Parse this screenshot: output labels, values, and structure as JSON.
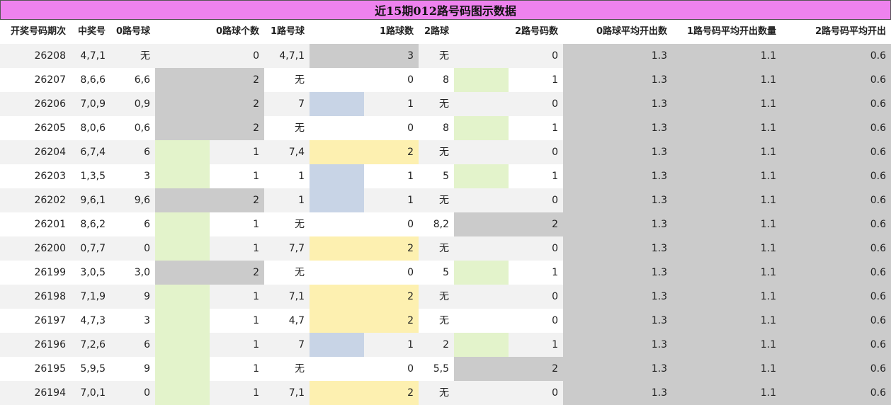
{
  "title": "近15期012路号码图示数据",
  "headers": [
    "开奖号码期次",
    "中奖号",
    "0路号球",
    "0路球个数",
    "1路号球",
    "1路球数",
    "2路球",
    "2路号码数",
    "0路球平均开出数",
    "1路号码平均开出数量",
    "2路号码平均开出"
  ],
  "colors": {
    "title_bg": "#ee82ee",
    "gray": "#cbcbcb",
    "green": "#e3f3cb",
    "blue": "#c8d4e6",
    "yellow": "#fdf0b0"
  },
  "rows": [
    {
      "period": "26208",
      "draw": "4,7,1",
      "r0": "无",
      "c0": "0",
      "r1": "4,7,1",
      "c1": "3",
      "r2": "无",
      "c2": "0",
      "a0": "1.3",
      "a1": "1.1",
      "a2": "0.6"
    },
    {
      "period": "26207",
      "draw": "8,6,6",
      "r0": "6,6",
      "c0": "2",
      "r1": "无",
      "c1": "0",
      "r2": "8",
      "c2": "1",
      "a0": "1.3",
      "a1": "1.1",
      "a2": "0.6"
    },
    {
      "period": "26206",
      "draw": "7,0,9",
      "r0": "0,9",
      "c0": "2",
      "r1": "7",
      "c1": "1",
      "r2": "无",
      "c2": "0",
      "a0": "1.3",
      "a1": "1.1",
      "a2": "0.6"
    },
    {
      "period": "26205",
      "draw": "8,0,6",
      "r0": "0,6",
      "c0": "2",
      "r1": "无",
      "c1": "0",
      "r2": "8",
      "c2": "1",
      "a0": "1.3",
      "a1": "1.1",
      "a2": "0.6"
    },
    {
      "period": "26204",
      "draw": "6,7,4",
      "r0": "6",
      "c0": "1",
      "r1": "7,4",
      "c1": "2",
      "r2": "无",
      "c2": "0",
      "a0": "1.3",
      "a1": "1.1",
      "a2": "0.6"
    },
    {
      "period": "26203",
      "draw": "1,3,5",
      "r0": "3",
      "c0": "1",
      "r1": "1",
      "c1": "1",
      "r2": "5",
      "c2": "1",
      "a0": "1.3",
      "a1": "1.1",
      "a2": "0.6"
    },
    {
      "period": "26202",
      "draw": "9,6,1",
      "r0": "9,6",
      "c0": "2",
      "r1": "1",
      "c1": "1",
      "r2": "无",
      "c2": "0",
      "a0": "1.3",
      "a1": "1.1",
      "a2": "0.6"
    },
    {
      "period": "26201",
      "draw": "8,6,2",
      "r0": "6",
      "c0": "1",
      "r1": "无",
      "c1": "0",
      "r2": "8,2",
      "c2": "2",
      "a0": "1.3",
      "a1": "1.1",
      "a2": "0.6"
    },
    {
      "period": "26200",
      "draw": "0,7,7",
      "r0": "0",
      "c0": "1",
      "r1": "7,7",
      "c1": "2",
      "r2": "无",
      "c2": "0",
      "a0": "1.3",
      "a1": "1.1",
      "a2": "0.6"
    },
    {
      "period": "26199",
      "draw": "3,0,5",
      "r0": "3,0",
      "c0": "2",
      "r1": "无",
      "c1": "0",
      "r2": "5",
      "c2": "1",
      "a0": "1.3",
      "a1": "1.1",
      "a2": "0.6"
    },
    {
      "period": "26198",
      "draw": "7,1,9",
      "r0": "9",
      "c0": "1",
      "r1": "7,1",
      "c1": "2",
      "r2": "无",
      "c2": "0",
      "a0": "1.3",
      "a1": "1.1",
      "a2": "0.6"
    },
    {
      "period": "26197",
      "draw": "4,7,3",
      "r0": "3",
      "c0": "1",
      "r1": "4,7",
      "c1": "2",
      "r2": "无",
      "c2": "0",
      "a0": "1.3",
      "a1": "1.1",
      "a2": "0.6"
    },
    {
      "period": "26196",
      "draw": "7,2,6",
      "r0": "6",
      "c0": "1",
      "r1": "7",
      "c1": "1",
      "r2": "2",
      "c2": "1",
      "a0": "1.3",
      "a1": "1.1",
      "a2": "0.6"
    },
    {
      "period": "26195",
      "draw": "5,9,5",
      "r0": "9",
      "c0": "1",
      "r1": "无",
      "c1": "0",
      "r2": "5,5",
      "c2": "2",
      "a0": "1.3",
      "a1": "1.1",
      "a2": "0.6"
    },
    {
      "period": "26194",
      "draw": "7,0,1",
      "r0": "0",
      "c0": "1",
      "r1": "7,1",
      "c1": "2",
      "r2": "无",
      "c2": "0",
      "a0": "1.3",
      "a1": "1.1",
      "a2": "0.6"
    }
  ]
}
